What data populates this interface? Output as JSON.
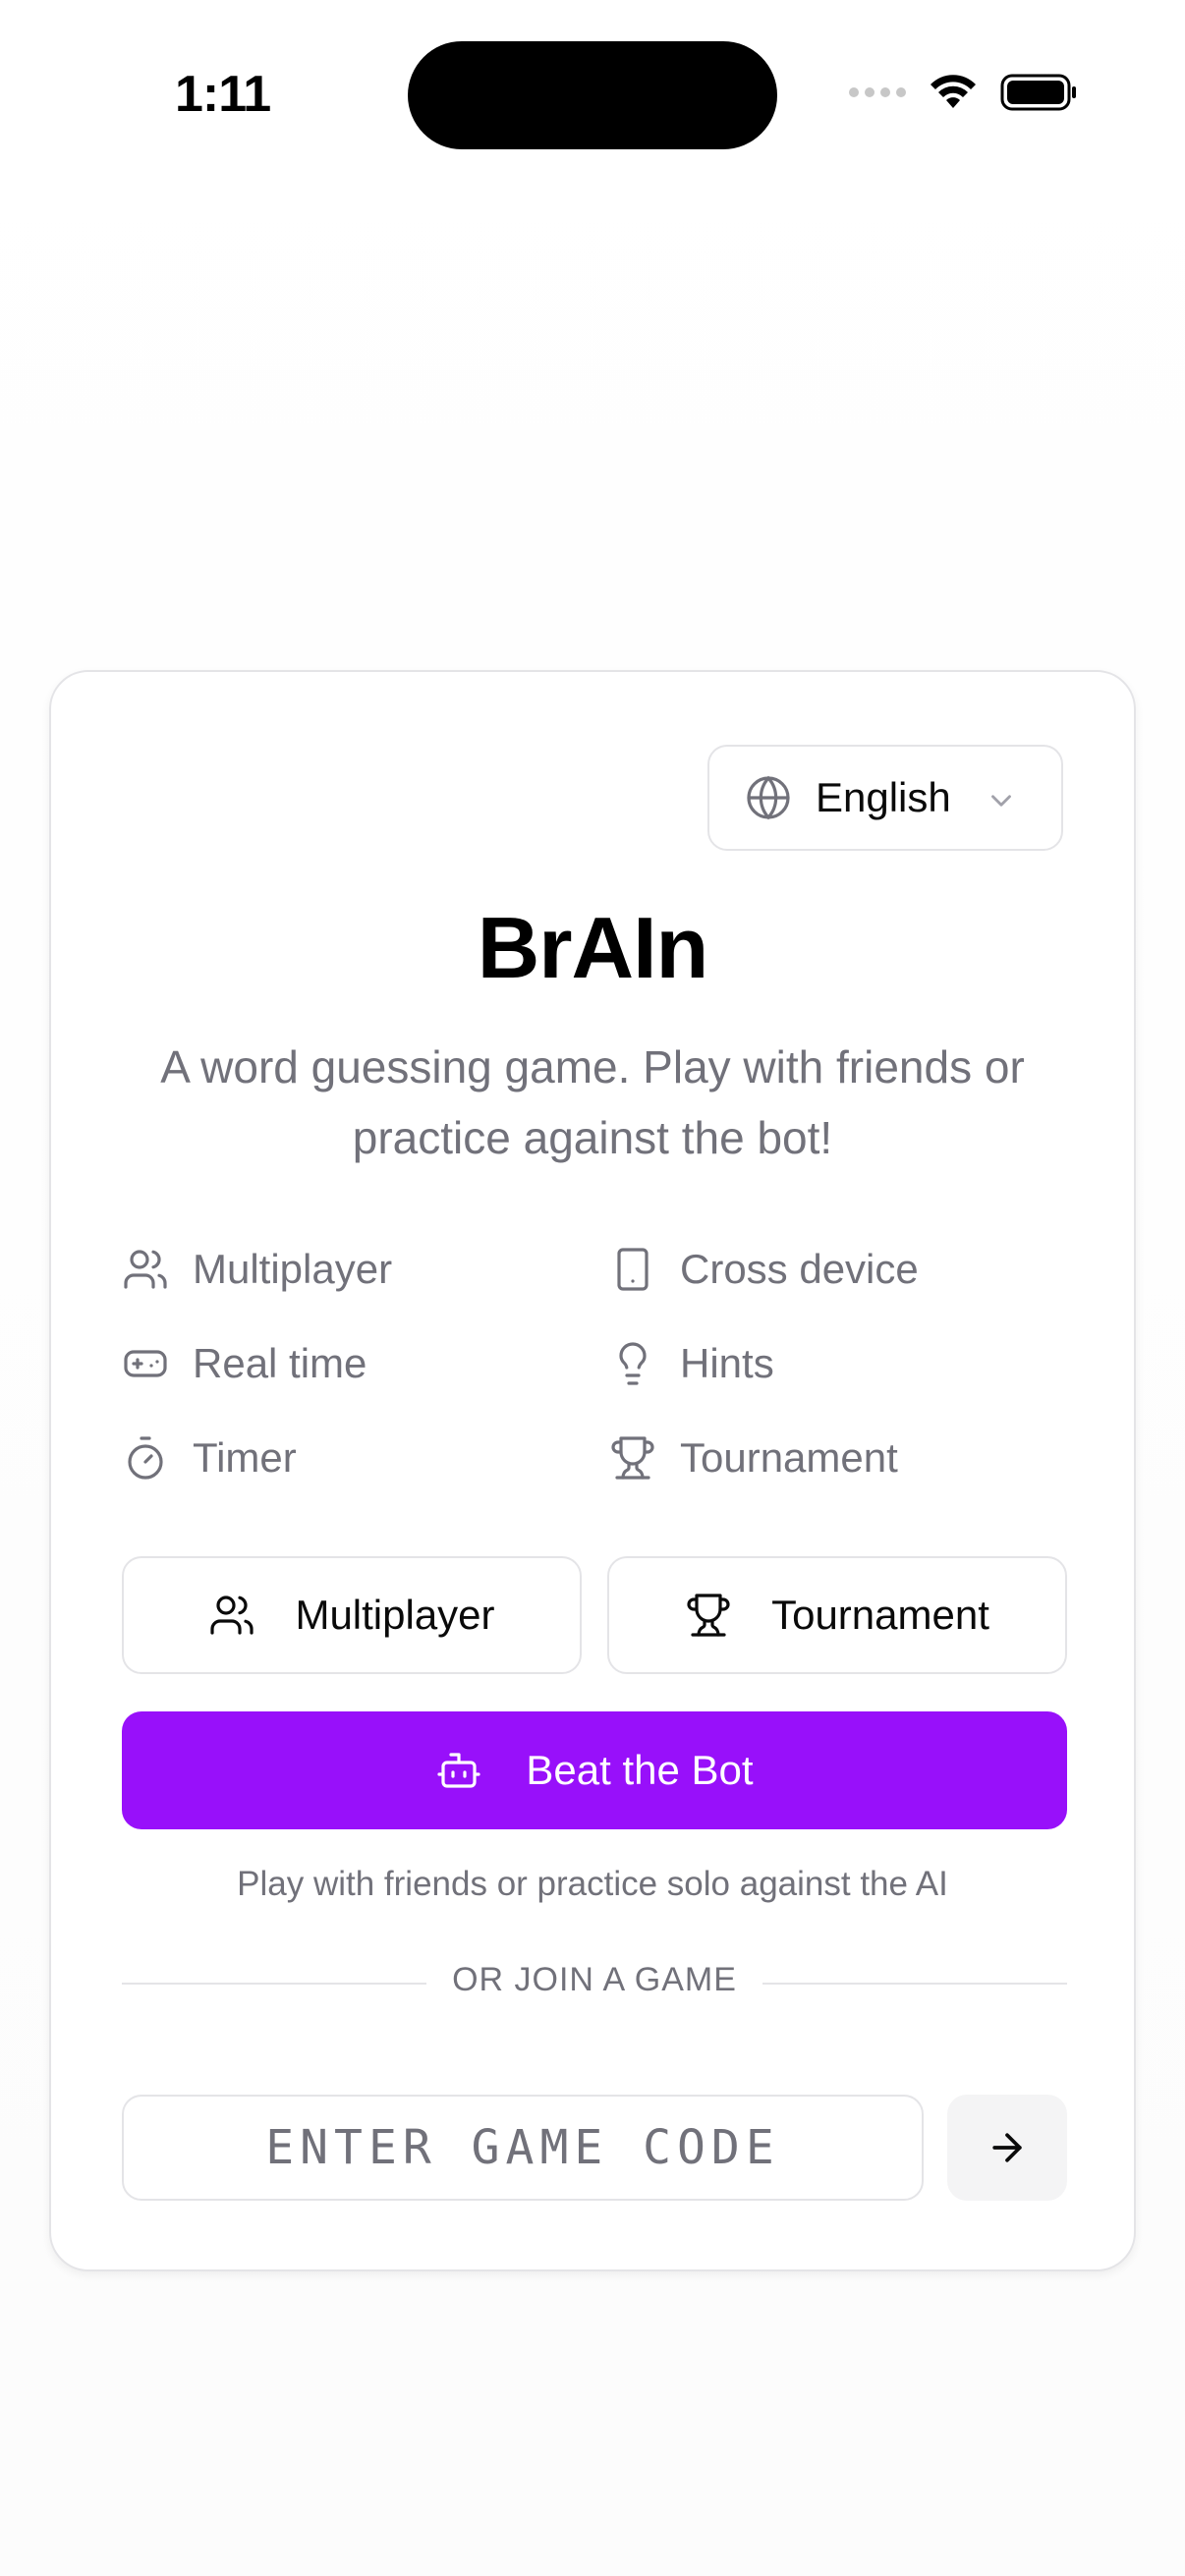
{
  "status_bar": {
    "time": "1:11"
  },
  "language": {
    "selected": "English"
  },
  "app": {
    "title": "BrAIn",
    "subtitle": "A word guessing game. Play with friends or practice against the bot!"
  },
  "features": [
    {
      "label": "Multiplayer",
      "icon": "users-icon"
    },
    {
      "label": "Cross device",
      "icon": "smartphone-icon"
    },
    {
      "label": "Real time",
      "icon": "gamepad-icon"
    },
    {
      "label": "Hints",
      "icon": "lightbulb-icon"
    },
    {
      "label": "Timer",
      "icon": "timer-icon"
    },
    {
      "label": "Tournament",
      "icon": "trophy-icon"
    }
  ],
  "actions": {
    "multiplayer_label": "Multiplayer",
    "tournament_label": "Tournament",
    "bot_label": "Beat the Bot",
    "helper_text": "Play with friends or practice solo against the AI"
  },
  "join": {
    "divider_text": "OR JOIN A GAME",
    "code_placeholder": "ENTER GAME CODE",
    "code_value": ""
  },
  "colors": {
    "primary": "#9810fa",
    "muted_text": "#71717a",
    "border": "#e4e4e7"
  }
}
